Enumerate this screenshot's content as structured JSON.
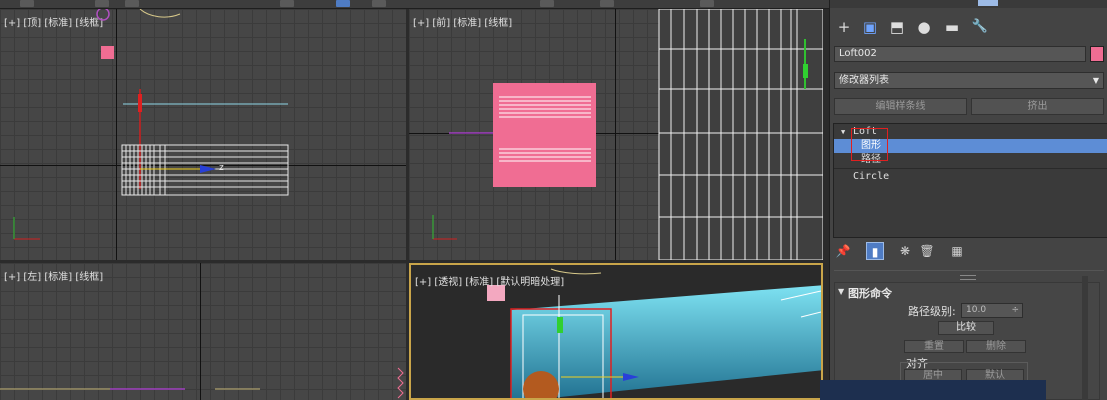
{
  "viewports": {
    "top": {
      "label": "[+] [顶] [标准] [线框]"
    },
    "front": {
      "label": "[+] [前] [标准] [线框]"
    },
    "left": {
      "label": "[+] [左] [标准] [线框]"
    },
    "perspective": {
      "label": "[+] [透视] [标准] [默认明暗处理]"
    }
  },
  "gizmo_letters": {
    "z": "z"
  },
  "panel": {
    "tab_icons": [
      "create-icon",
      "modify-icon",
      "hierarchy-icon",
      "motion-icon",
      "display-icon",
      "utilities-icon"
    ],
    "tab_glyphs": [
      "+",
      "▣",
      "⬒",
      "●",
      "▬",
      "🔧"
    ],
    "object_name": "Loft002",
    "modifier_list": "修改器列表",
    "dropdown_arrow": "▼",
    "edit_spline_button": "编辑样条线",
    "extrude_button": "挤出",
    "stack": {
      "loft_expand": "▼",
      "loft": "Loft",
      "shape": "图形",
      "path": "路径",
      "circle": "Circle"
    },
    "toolbar_glyphs": {
      "pin": "📌",
      "show_end_result": "▮",
      "make_unique": "❋",
      "remove_modifier": "🗑",
      "configure": "▦"
    },
    "rollout": {
      "arrow": "▼",
      "title": "图形命令",
      "path_level_label": "路径级别:",
      "path_level_value": "10.0",
      "spinner_arrows": "÷",
      "compare_button": "比较",
      "reset_button": "重置",
      "delete_button": "删除",
      "align_label": "对齐",
      "center_button": "居中",
      "default_button": "默认"
    }
  },
  "colors": {
    "pink": "#f06d93",
    "selection_blue": "#5d8dd6",
    "highlight_red": "#e02020",
    "active_border": "#c9a54a",
    "cyan": "#46c7e0"
  }
}
